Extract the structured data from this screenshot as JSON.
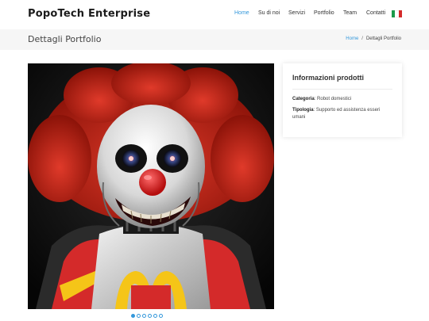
{
  "header": {
    "brand": "PopoTech Enterprise",
    "nav": [
      {
        "label": "Home",
        "active": true
      },
      {
        "label": "Su di noi"
      },
      {
        "label": "Servizi"
      },
      {
        "label": "Portfolio"
      },
      {
        "label": "Team"
      },
      {
        "label": "Contatti"
      }
    ],
    "language_flag": "italian-flag-icon",
    "flag_colors": [
      "#1a9a4a",
      "#ffffff",
      "#d42a2a"
    ]
  },
  "breadcrumb": {
    "title": "Dettagli Portfolio",
    "home": "Home",
    "separator": "/",
    "current": "Dettagli Portfolio"
  },
  "info": {
    "title": "Informazioni prodotti",
    "category_label": "Categoria",
    "category_value": "Robot domestici",
    "type_label": "Tipologia",
    "type_value": "Supporto ed assistenza esseri umani"
  },
  "carousel": {
    "slide_count": 6,
    "active_index": 0
  },
  "colors": {
    "accent": "#3498db",
    "title": "#1b1b1b",
    "breadcrumb_bg": "#f6f6f6"
  }
}
